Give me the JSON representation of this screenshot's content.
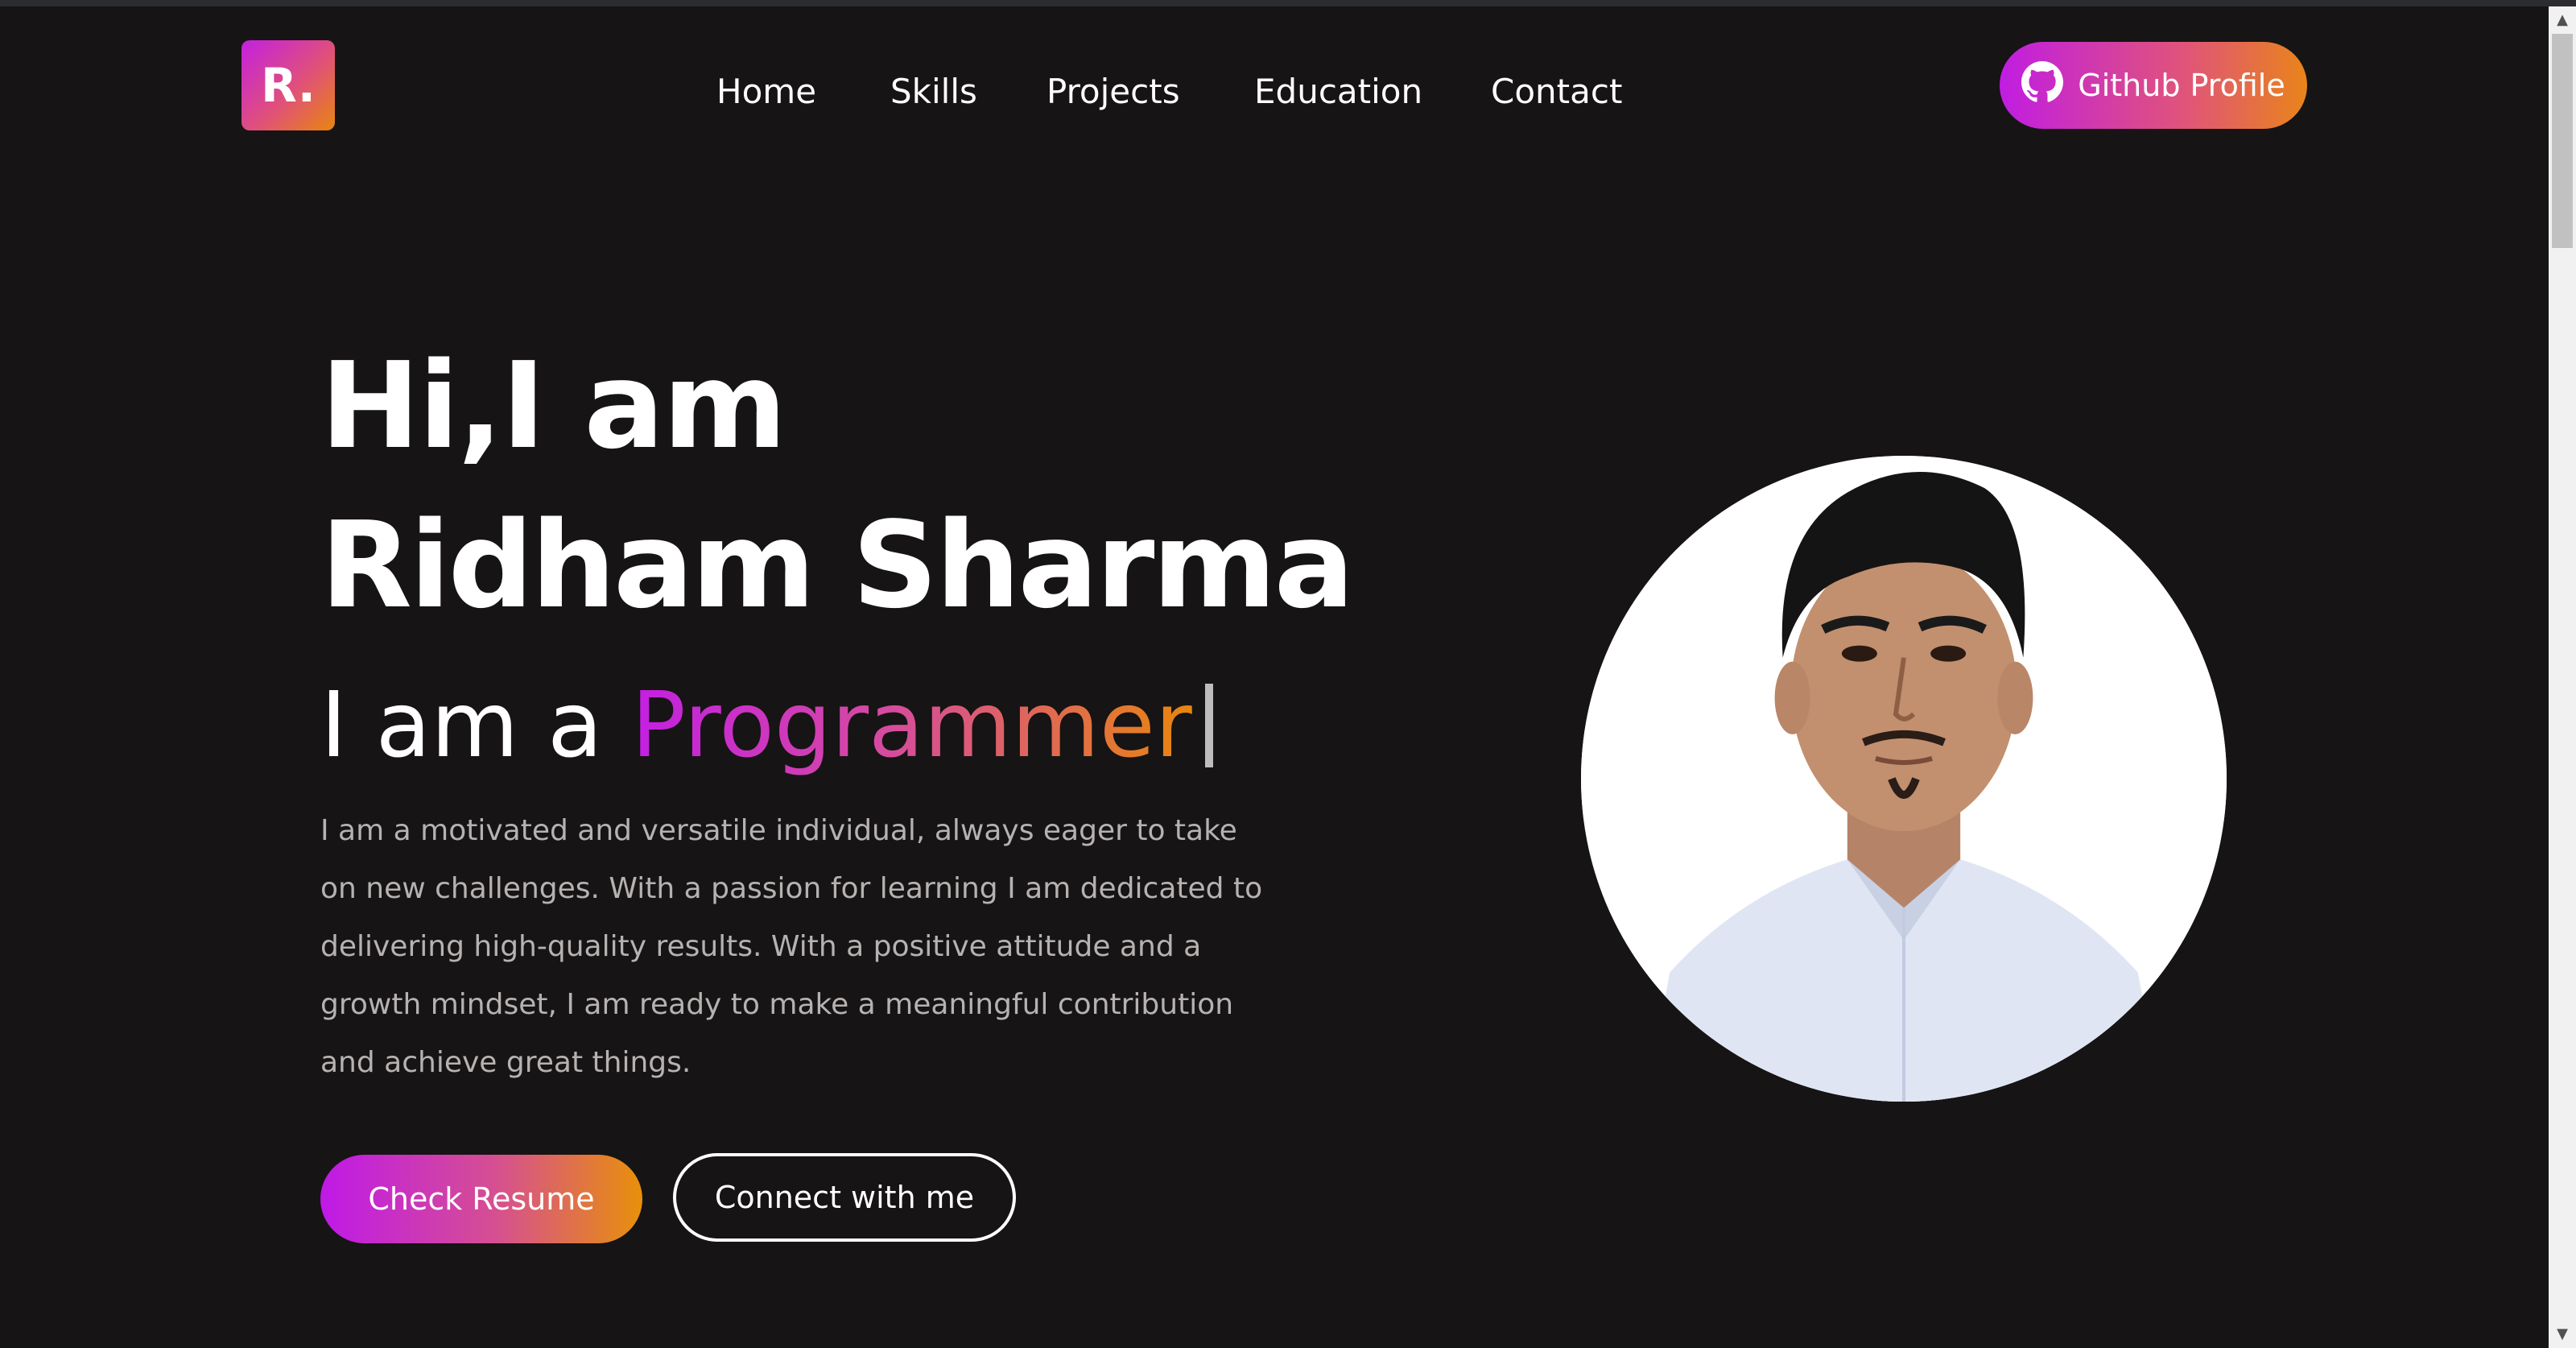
{
  "logo": {
    "text": "R."
  },
  "nav": {
    "items": [
      {
        "label": "Home"
      },
      {
        "label": "Skills"
      },
      {
        "label": "Projects"
      },
      {
        "label": "Education"
      },
      {
        "label": "Contact"
      }
    ]
  },
  "github": {
    "label": "Github Profile",
    "icon": "github-icon"
  },
  "hero": {
    "greeting": "Hi,I am",
    "name": "Ridham Sharma",
    "role_prefix": "I am a",
    "role": "Programmer",
    "description": "I am a motivated and versatile individual, always eager to take on new challenges. With a passion for learning I am dedicated to delivering high-quality results. With a positive attitude and a growth mindset, I am ready to make a meaningful contribution and achieve great things."
  },
  "buttons": {
    "resume": "Check Resume",
    "connect": "Connect with me"
  },
  "colors": {
    "background": "#161414",
    "gradient_start": "#c01de2",
    "gradient_end": "#e8860e",
    "text_muted": "#b7b2b2"
  }
}
